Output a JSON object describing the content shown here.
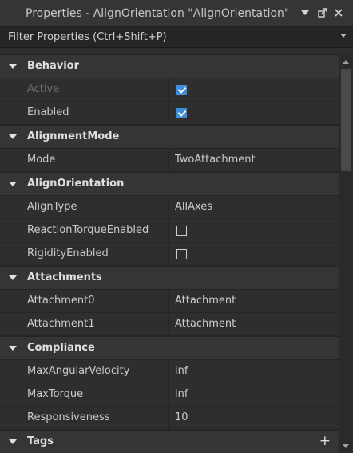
{
  "window": {
    "title": "Properties - AlignOrientation \"AlignOrientation\"",
    "icons": [
      "chevron-down-icon",
      "undock-icon",
      "close-icon"
    ]
  },
  "filter": {
    "placeholder": "Filter Properties (Ctrl+Shift+P)"
  },
  "colors": {
    "checkbox_checked": "#3a8fd8",
    "header_bg": "#353535",
    "panel_bg": "#2e2e2e"
  },
  "categories": [
    {
      "label": "Behavior",
      "props": [
        {
          "name": "Active",
          "type": "checkbox",
          "checked": true,
          "disabled": true
        },
        {
          "name": "Enabled",
          "type": "checkbox",
          "checked": true
        }
      ]
    },
    {
      "label": "AlignmentMode",
      "props": [
        {
          "name": "Mode",
          "type": "text",
          "value": "TwoAttachment"
        }
      ]
    },
    {
      "label": "AlignOrientation",
      "props": [
        {
          "name": "AlignType",
          "type": "text",
          "value": "AllAxes"
        },
        {
          "name": "ReactionTorqueEnabled",
          "type": "checkbox",
          "checked": false
        },
        {
          "name": "RigidityEnabled",
          "type": "checkbox",
          "checked": false
        }
      ]
    },
    {
      "label": "Attachments",
      "props": [
        {
          "name": "Attachment0",
          "type": "text",
          "value": "Attachment"
        },
        {
          "name": "Attachment1",
          "type": "text",
          "value": "Attachment"
        }
      ]
    },
    {
      "label": "Compliance",
      "props": [
        {
          "name": "MaxAngularVelocity",
          "type": "text",
          "value": "inf"
        },
        {
          "name": "MaxTorque",
          "type": "text",
          "value": "inf"
        },
        {
          "name": "Responsiveness",
          "type": "text",
          "value": "10"
        }
      ]
    },
    {
      "label": "Tags",
      "add_icon": "+",
      "props": []
    }
  ]
}
